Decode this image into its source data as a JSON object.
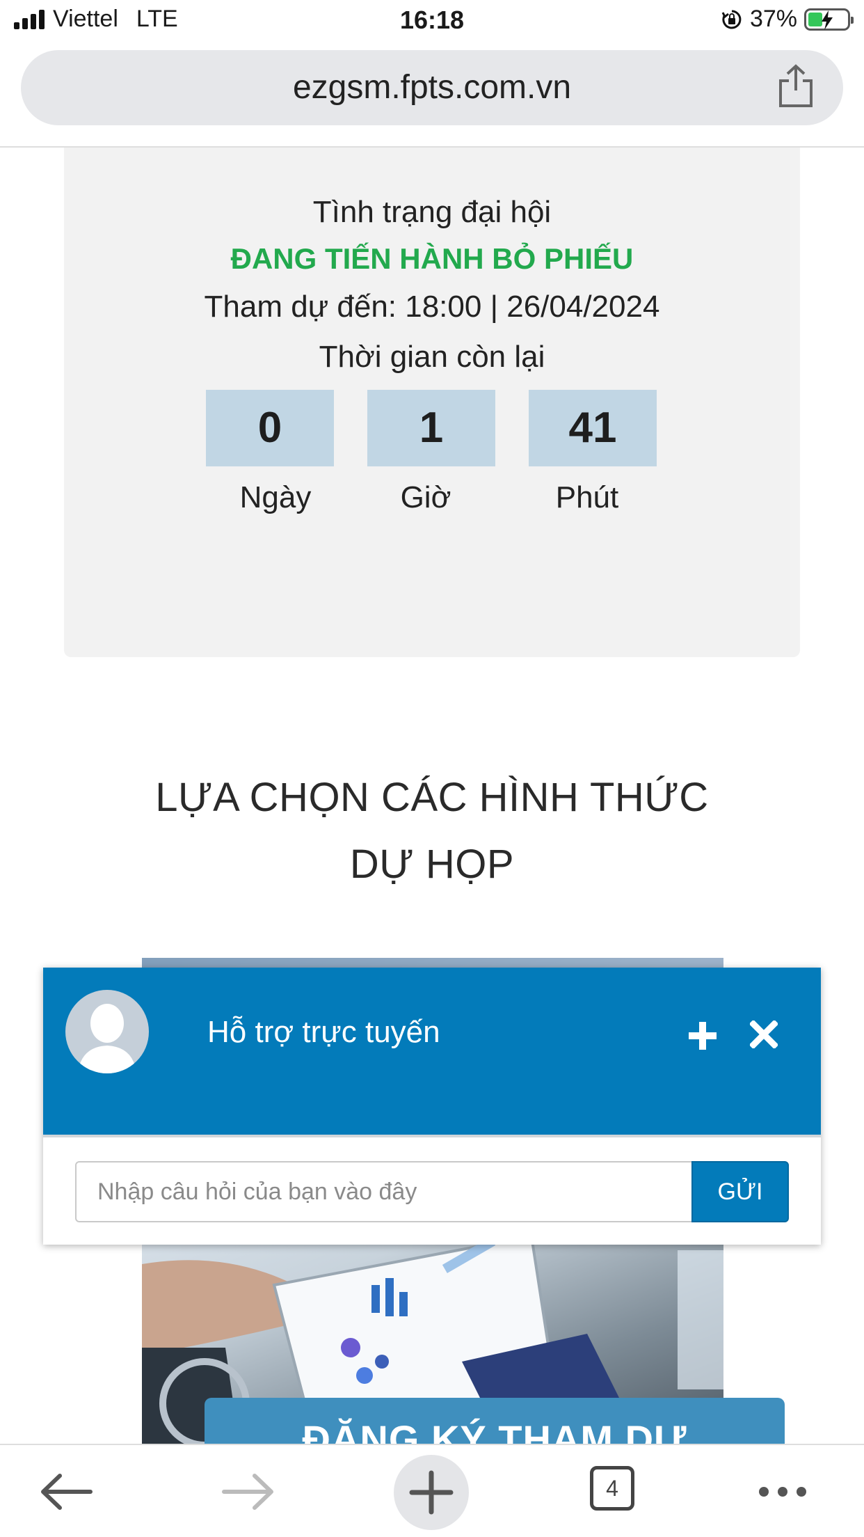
{
  "status_bar": {
    "carrier": "Viettel",
    "network": "LTE",
    "time": "16:18",
    "battery": "37%",
    "battery_level": 0.37
  },
  "browser": {
    "url": "ezgsm.fpts.com.vn",
    "tab_count": "4",
    "icons": [
      "share-icon",
      "back-icon",
      "forward-icon",
      "new-tab-icon",
      "tabs-icon",
      "more-icon"
    ]
  },
  "meeting_status": {
    "title": "Tình trạng đại hội",
    "state": "ĐANG TIẾN HÀNH BỎ PHIẾU",
    "state_color": "#22a94d",
    "deadline": "Tham dự đến: 18:00 | 26/04/2024",
    "remaining_label": "Thời gian còn lại",
    "countdown": [
      {
        "value": "0",
        "unit": "Ngày"
      },
      {
        "value": "1",
        "unit": "Giờ"
      },
      {
        "value": "41",
        "unit": "Phút"
      }
    ]
  },
  "options_section": {
    "title_line1": "LỰA CHỌN CÁC HÌNH THỨC",
    "title_line2": "DỰ HỌP",
    "register_button": "ĐĂNG KÝ THAM DỰ"
  },
  "support_chat": {
    "title": "Hỗ trợ trực tuyến",
    "input_placeholder": "Nhập câu hỏi của bạn vào đây",
    "send_label": "GỬI",
    "header_color": "#037bba"
  }
}
